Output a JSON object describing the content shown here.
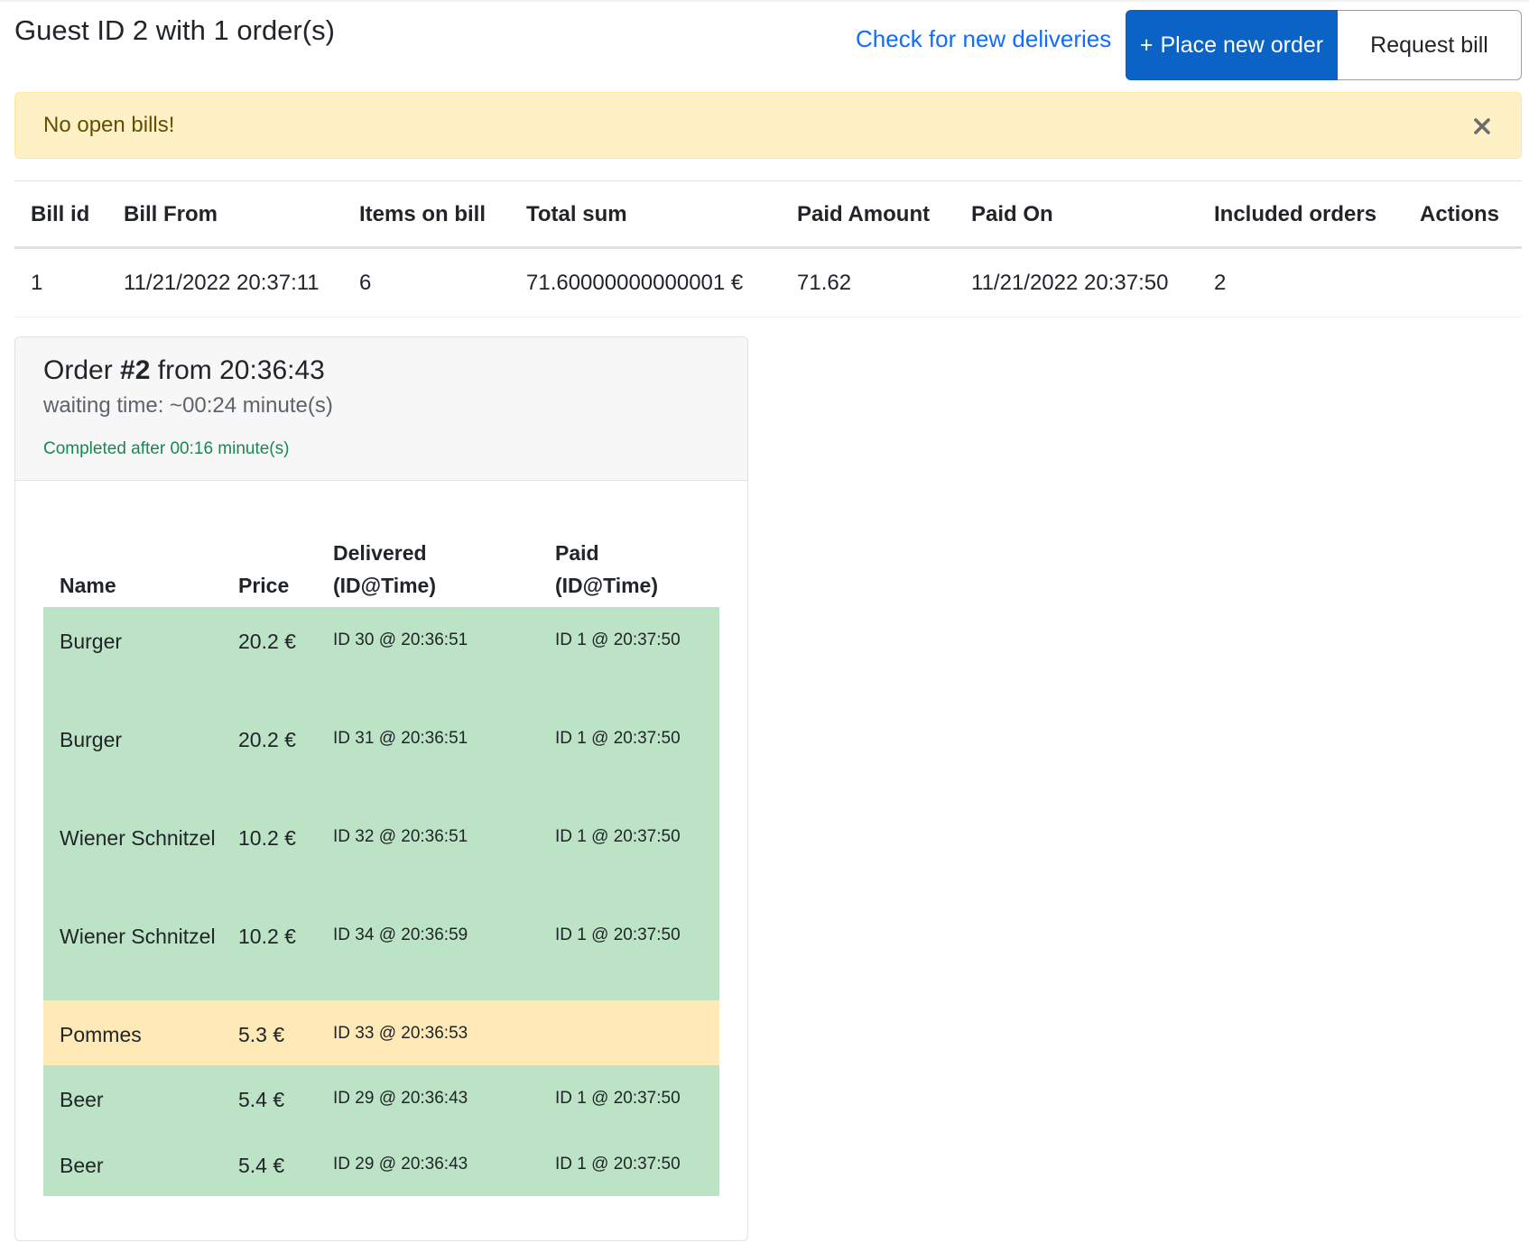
{
  "header": {
    "title": "Guest ID 2 with 1 order(s)",
    "check_deliveries": "Check for new deliveries",
    "place_order_icon": "+",
    "place_order": "Place new order",
    "request_bill": "Request bill"
  },
  "alert": {
    "text": "No open bills!",
    "close_icon": "close-icon"
  },
  "bill_table": {
    "headers": {
      "bill_id": "Bill id",
      "bill_from": "Bill From",
      "items": "Items on bill",
      "total": "Total sum",
      "paid_amount": "Paid Amount",
      "paid_on": "Paid On",
      "orders": "Included orders",
      "actions": "Actions"
    },
    "rows": [
      {
        "bill_id": "1",
        "bill_from": "11/21/2022 20:37:11",
        "items": "6",
        "total": "71.60000000000001 €",
        "paid_amount": "71.62",
        "paid_on": "11/21/2022 20:37:50",
        "orders": "2",
        "actions": ""
      }
    ]
  },
  "order": {
    "title_prefix": "Order ",
    "number": "#2",
    "title_suffix": " from 20:36:43",
    "waiting": "waiting time: ~00:24 minute(s)",
    "completed": "Completed after 00:16 minute(s)",
    "columns": {
      "name": "Name",
      "price": "Price",
      "delivered_1": "Delivered",
      "delivered_2": "(ID@Time)",
      "paid_1": "Paid",
      "paid_2": "(ID@Time)"
    },
    "items": [
      {
        "name": "Burger",
        "price": "20.2 €",
        "delivered": "ID 30 @ 20:36:51",
        "paid": "ID 1 @ 20:37:50",
        "status": "paid"
      },
      {
        "name": "Burger",
        "price": "20.2 €",
        "delivered": "ID 31 @ 20:36:51",
        "paid": "ID 1 @ 20:37:50",
        "status": "paid"
      },
      {
        "name": "Wiener Schnitzel",
        "price": "10.2 €",
        "delivered": "ID 32 @ 20:36:51",
        "paid": "ID 1 @ 20:37:50",
        "status": "paid"
      },
      {
        "name": "Wiener Schnitzel",
        "price": "10.2 €",
        "delivered": "ID 34 @ 20:36:59",
        "paid": "ID 1 @ 20:37:50",
        "status": "paid"
      },
      {
        "name": "Pommes",
        "price": "5.3 €",
        "delivered": "ID 33 @ 20:36:53",
        "paid": "",
        "status": "unpaid"
      },
      {
        "name": "Beer",
        "price": "5.4 €",
        "delivered": "ID 29 @ 20:36:43",
        "paid": "ID 1 @ 20:37:50",
        "status": "paid"
      },
      {
        "name": "Beer",
        "price": "5.4 €",
        "delivered": "ID 29 @ 20:36:43",
        "paid": "ID 1 @ 20:37:50",
        "status": "paid"
      }
    ]
  },
  "colors": {
    "primary": "#0b63c5",
    "link": "#0d6efd",
    "alert_bg": "#fff1c6",
    "alert_text": "#664d03",
    "paid_row": "#bce3c6",
    "unpaid_row": "#ffe9b6",
    "success": "#198754"
  }
}
